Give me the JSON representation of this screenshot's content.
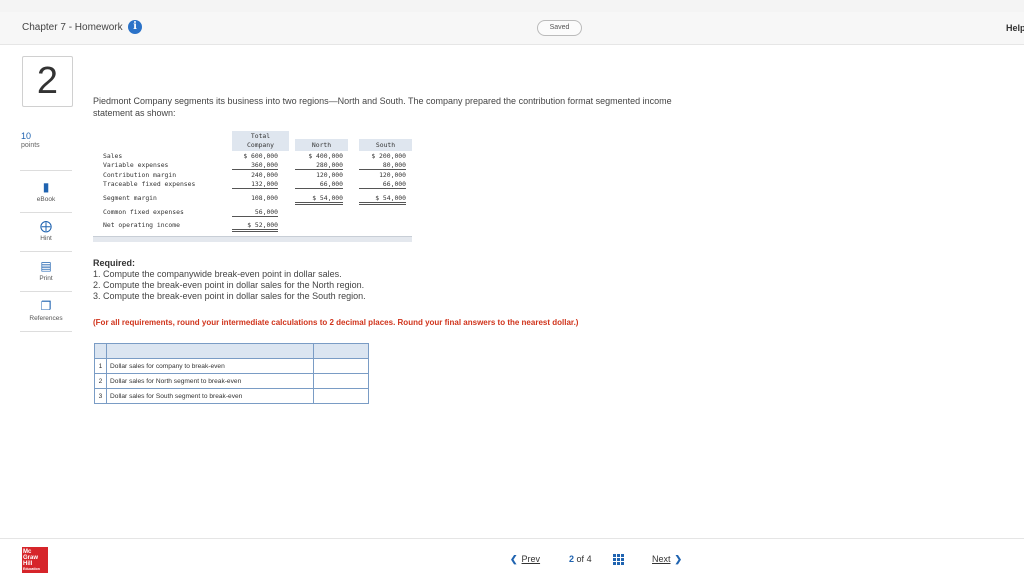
{
  "header": {
    "assignment_title": "Chapter 7 - Homework",
    "saved_label": "Saved",
    "help_label": "Help"
  },
  "question": {
    "number": "2",
    "points_value": "10",
    "points_label": "points",
    "intro": "Piedmont Company segments its business into two regions—North and South. The company prepared the contribution format segmented income statement as shown:"
  },
  "tools": {
    "ebook": "eBook",
    "hint": "Hint",
    "print": "Print",
    "references": "References"
  },
  "statement": {
    "col_total_line1": "Total",
    "col_total_line2": "Company",
    "col_north": "North",
    "col_south": "South",
    "rows": [
      {
        "label": "Sales",
        "total": "$ 600,000",
        "north": "$ 400,000",
        "south": "$ 200,000"
      },
      {
        "label": "Variable expenses",
        "total": "360,000",
        "north": "280,000",
        "south": "80,000"
      },
      {
        "label": "Contribution margin",
        "total": "240,000",
        "north": "120,000",
        "south": "120,000"
      },
      {
        "label": "Traceable fixed expenses",
        "total": "132,000",
        "north": "66,000",
        "south": "66,000"
      },
      {
        "label": "Segment margin",
        "total": "108,000",
        "north": "$  54,000",
        "south": "$  54,000"
      },
      {
        "label": "Common fixed expenses",
        "total": "56,000"
      },
      {
        "label": "Net operating income",
        "total": "$  52,000"
      }
    ]
  },
  "required": {
    "title": "Required:",
    "items": [
      "1. Compute the companywide break-even point in dollar sales.",
      "2. Compute the break-even point in dollar sales for the North region.",
      "3. Compute the break-even point in dollar sales for the South region."
    ],
    "note": "(For all requirements, round your intermediate calculations to 2 decimal places. Round your final answers to the nearest dollar.)"
  },
  "answer_table": {
    "rows": [
      {
        "num": "1",
        "desc": "Dollar sales for company to break-even",
        "value": ""
      },
      {
        "num": "2",
        "desc": "Dollar sales for North segment to break-even",
        "value": ""
      },
      {
        "num": "3",
        "desc": "Dollar sales for South segment to break-even",
        "value": ""
      }
    ]
  },
  "footer": {
    "logo_line1": "Mc",
    "logo_line2": "Graw",
    "logo_line3": "Hill",
    "logo_line4": "Education",
    "prev_label": "Prev",
    "page_current": "2",
    "page_of": "of",
    "page_total": "4",
    "next_label": "Next"
  }
}
